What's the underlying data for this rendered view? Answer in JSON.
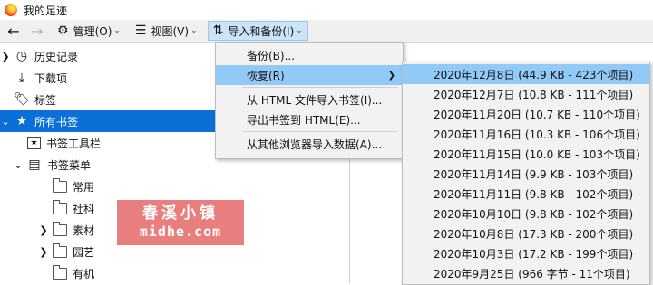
{
  "window": {
    "title": "我的足迹"
  },
  "toolbar": {
    "manage_label": "管理(O)",
    "view_label": "视图(V)",
    "import_label": "导入和备份(I)"
  },
  "tree": {
    "history": "历史记录",
    "downloads": "下载项",
    "tags": "标签",
    "all_bookmarks": "所有书签",
    "bookmarks_toolbar": "书签工具栏",
    "bookmarks_menu": "书签菜单",
    "folders": [
      "常用",
      "社科",
      "素材",
      "园艺",
      "有机"
    ]
  },
  "import_menu": {
    "backup": "备份(B)...",
    "restore": "恢复(R)",
    "import_html": "从 HTML 文件导入书签(I)...",
    "export_html": "导出书签到 HTML(E)...",
    "import_other": "从其他浏览器导入数据(A)..."
  },
  "restore_submenu": [
    "2020年12月8日 (44.9 KB - 423个项目)",
    "2020年12月7日 (10.8 KB - 111个项目)",
    "2020年11月20日 (10.7 KB - 110个项目)",
    "2020年11月16日 (10.3 KB - 106个项目)",
    "2020年11月15日 (10.0 KB - 103个项目)",
    "2020年11月14日 (9.9 KB - 103个项目)",
    "2020年11月11日 (9.8 KB - 102个项目)",
    "2020年10月10日 (9.8 KB - 102个项目)",
    "2020年10月8日 (17.3 KB - 200个项目)",
    "2020年10月3日 (17.2 KB - 199个项目)",
    "2020年9月25日 (966 字节 - 11个项目)"
  ],
  "watermark": {
    "line1": "春溪小镇",
    "line2": "midhe.com"
  },
  "colors": {
    "selected": "#0a6fd6",
    "menu_highlight": "#91c9f7",
    "watermark": "#e67373"
  }
}
